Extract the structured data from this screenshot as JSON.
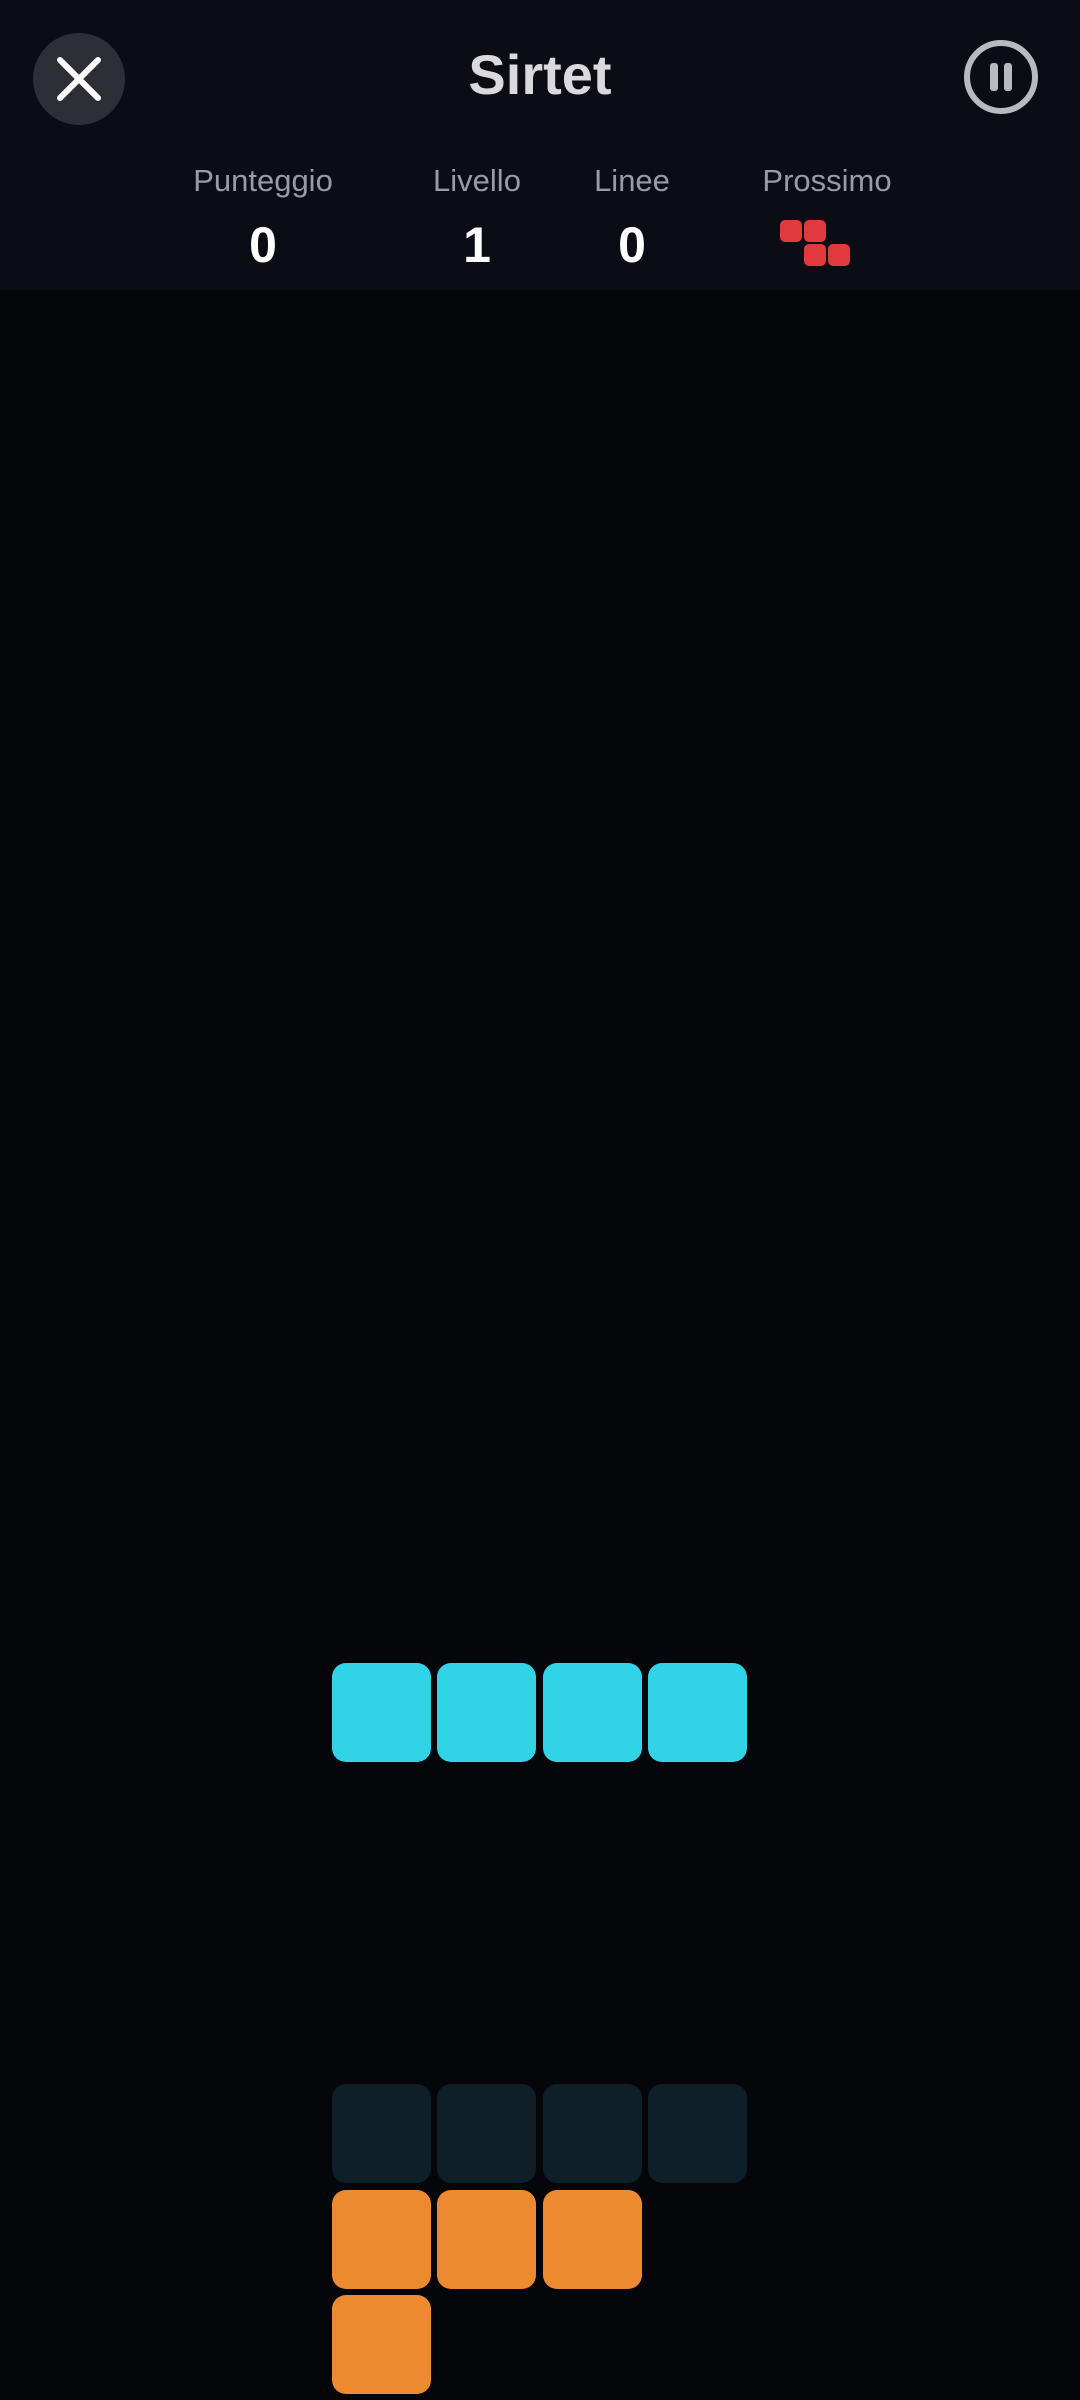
{
  "header": {
    "title": "Sirtet",
    "close_icon": "close-icon",
    "pause_icon": "pause-icon"
  },
  "stats": {
    "score_label": "Punteggio",
    "score_value": "0",
    "level_label": "Livello",
    "level_value": "1",
    "lines_label": "Linee",
    "lines_value": "0",
    "next_label": "Prossimo",
    "next_piece": "Z"
  },
  "board": {
    "active_piece": "I",
    "ghost_piece": "I",
    "locked_piece": "L"
  },
  "colors": {
    "background": "#05060a",
    "header": "#0b0c14",
    "active_piece": "#31d4e6",
    "ghost_piece": "#0e1f2a",
    "locked_piece": "#ed892f",
    "next_piece": "#e0393e"
  }
}
